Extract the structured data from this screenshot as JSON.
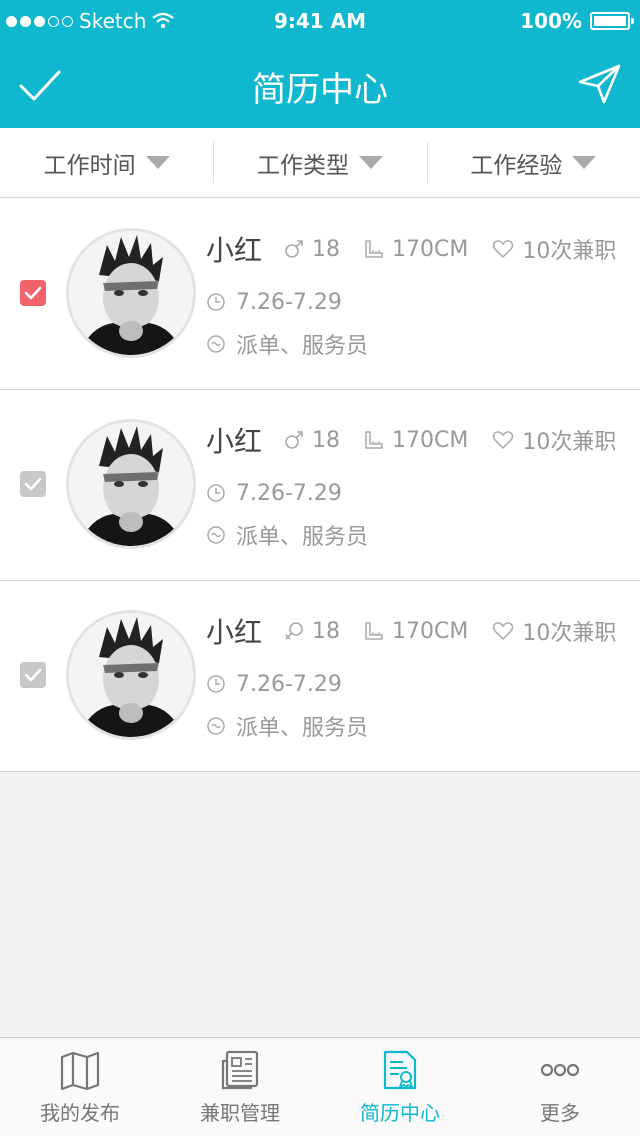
{
  "status_bar": {
    "carrier": "Sketch",
    "time": "9:41 AM",
    "battery": "100%"
  },
  "nav": {
    "title": "简历中心"
  },
  "filters": [
    {
      "label": "工作时间"
    },
    {
      "label": "工作类型"
    },
    {
      "label": "工作经验"
    }
  ],
  "resumes": [
    {
      "name": "小红",
      "gender_icon": "male-icon",
      "age": "18",
      "height": "170CM",
      "jobs": "10次兼职",
      "period": "7.26-7.29",
      "positions": "派单、服务员",
      "checked": true
    },
    {
      "name": "小红",
      "gender_icon": "male-icon",
      "age": "18",
      "height": "170CM",
      "jobs": "10次兼职",
      "period": "7.26-7.29",
      "positions": "派单、服务员",
      "checked": false
    },
    {
      "name": "小红",
      "gender_icon": "female-icon",
      "age": "18",
      "height": "170CM",
      "jobs": "10次兼职",
      "period": "7.26-7.29",
      "positions": "派单、服务员",
      "checked": false
    }
  ],
  "tabs": [
    {
      "label": "我的发布",
      "icon": "map-icon"
    },
    {
      "label": "兼职管理",
      "icon": "news-icon"
    },
    {
      "label": "简历中心",
      "icon": "resume-icon",
      "active": true
    },
    {
      "label": "更多",
      "icon": "more-icon"
    }
  ],
  "colors": {
    "primary": "#0fb8cf",
    "checked": "#f3636b",
    "unchecked": "#c8c8c8"
  }
}
